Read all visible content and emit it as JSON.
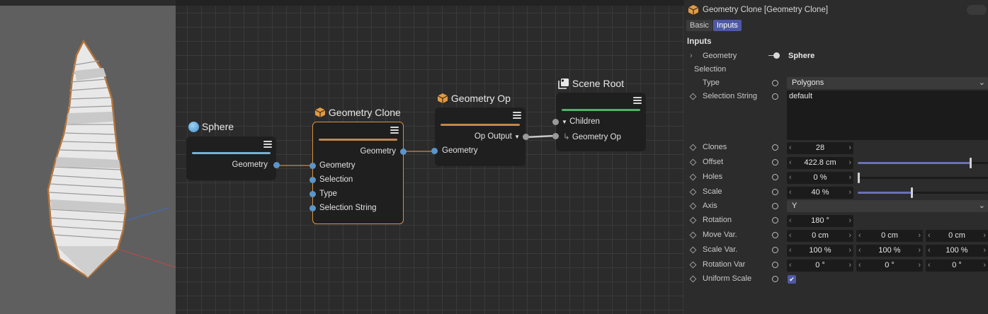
{
  "colors": {
    "accent": "#4e59a5",
    "selected_node_border": "#d9913d",
    "port_blue": "#5b95c9",
    "sphere_bar": "#6fb3dc",
    "clone_bar": "#c2874b",
    "scene_root_bar": "#52b16b"
  },
  "nodes": {
    "sphere": {
      "title": "Sphere",
      "icon": "sphere-icon",
      "outputs": [
        "Geometry"
      ]
    },
    "geometry_clone": {
      "title": "Geometry Clone",
      "icon": "geometry-cube-icon",
      "outputs": [
        "Geometry"
      ],
      "inputs": [
        "Geometry",
        "Selection",
        "Type",
        "Selection String"
      ]
    },
    "geometry_op": {
      "title": "Geometry Op",
      "icon": "geometry-cube-icon",
      "outputs": [
        "Op Output"
      ],
      "inputs": [
        "Geometry"
      ]
    },
    "scene_root": {
      "title": "Scene Root",
      "icon": "scene-root-icon",
      "children_label": "Children",
      "child": "Geometry Op"
    }
  },
  "panel": {
    "title": "Geometry Clone [Geometry Clone]",
    "tabs": [
      "Basic",
      "Inputs"
    ],
    "active_tab": "Inputs",
    "section": "Inputs",
    "geometry": {
      "label": "Geometry",
      "value": "Sphere"
    },
    "selection": {
      "label": "Selection"
    },
    "type": {
      "label": "Type",
      "value": "Polygons"
    },
    "selection_string": {
      "label": "Selection String",
      "value": "default"
    },
    "clones": {
      "label": "Clones",
      "value": "28"
    },
    "offset": {
      "label": "Offset",
      "value": "422.8 cm",
      "slider": 0.97
    },
    "holes": {
      "label": "Holes",
      "value": "0 %",
      "slider": 0.0
    },
    "scale": {
      "label": "Scale",
      "value": "40 %",
      "slider": 0.4
    },
    "axis": {
      "label": "Axis",
      "value": "Y"
    },
    "rotation": {
      "label": "Rotation",
      "value": "180 °"
    },
    "move_var": {
      "label": "Move Var.",
      "values": [
        "0 cm",
        "0 cm",
        "0 cm"
      ]
    },
    "scale_var": {
      "label": "Scale Var.",
      "values": [
        "100 %",
        "100 %",
        "100 %"
      ]
    },
    "rotation_var": {
      "label": "Rotation Var",
      "values": [
        "0 °",
        "0 °",
        "0 °"
      ]
    },
    "uniform_scale": {
      "label": "Uniform Scale",
      "checked": true
    }
  }
}
